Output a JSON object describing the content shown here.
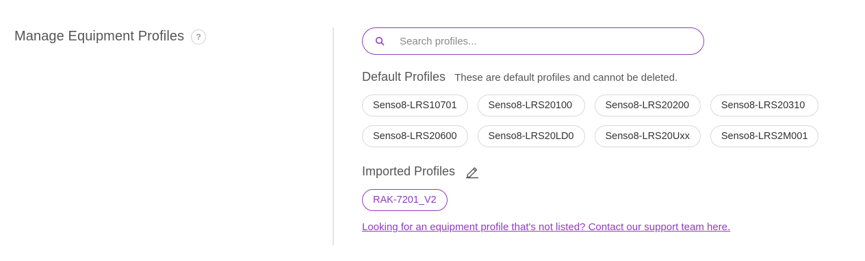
{
  "section": {
    "title": "Manage Equipment Profiles",
    "help_glyph": "?"
  },
  "search": {
    "placeholder": "Search profiles...",
    "value": ""
  },
  "default_profiles": {
    "title": "Default Profiles",
    "note": "These are default profiles and cannot be deleted.",
    "items": [
      "Senso8-LRS10701",
      "Senso8-LRS20100",
      "Senso8-LRS20200",
      "Senso8-LRS20310",
      "Senso8-LRS20600",
      "Senso8-LRS20LD0",
      "Senso8-LRS20Uxx",
      "Senso8-LRS2M001"
    ]
  },
  "imported_profiles": {
    "title": "Imported Profiles",
    "edit_icon": "pencil-icon",
    "items": [
      "RAK-7201_V2"
    ]
  },
  "support_link": "Looking for an equipment profile that's not listed? Contact our support team here.",
  "colors": {
    "accent": "#8e3dbd",
    "chip_border": "#d9d9d9",
    "divider": "#e3e3e3"
  }
}
